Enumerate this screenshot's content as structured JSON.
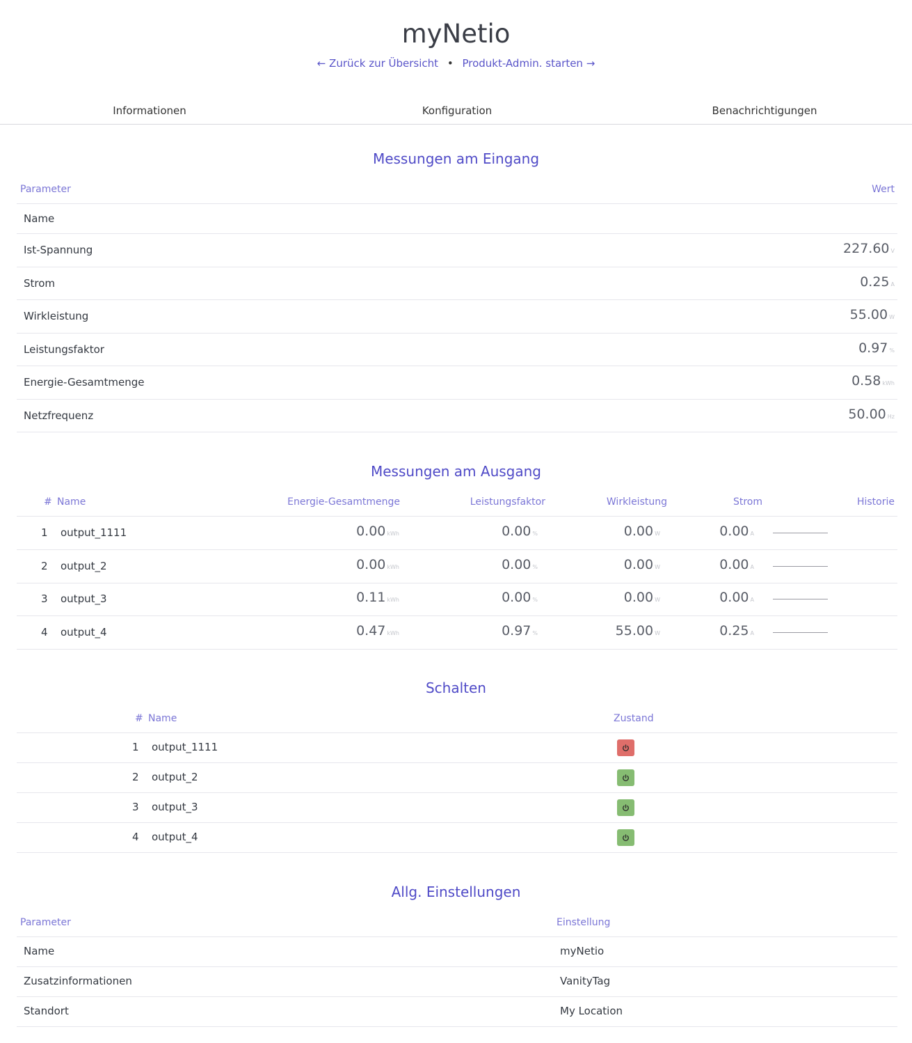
{
  "header": {
    "title": "myNetio",
    "back_link": "← Zurück zur Übersicht",
    "separator": "•",
    "admin_link": "Produkt-Admin. starten →"
  },
  "tabs": [
    "Informationen",
    "Konfiguration",
    "Benachrichtigungen"
  ],
  "input_section": {
    "title": "Messungen am Eingang",
    "col_param": "Parameter",
    "col_value": "Wert",
    "rows": [
      {
        "label": "Name",
        "value": "",
        "unit": ""
      },
      {
        "label": "Ist-Spannung",
        "value": "227.60",
        "unit": "V"
      },
      {
        "label": "Strom",
        "value": "0.25",
        "unit": "A"
      },
      {
        "label": "Wirkleistung",
        "value": "55.00",
        "unit": "W"
      },
      {
        "label": "Leistungsfaktor",
        "value": "0.97",
        "unit": "%"
      },
      {
        "label": "Energie-Gesamtmenge",
        "value": "0.58",
        "unit": "kWh"
      },
      {
        "label": "Netzfrequenz",
        "value": "50.00",
        "unit": "Hz"
      }
    ]
  },
  "output_section": {
    "title": "Messungen am Ausgang",
    "columns": {
      "num": "#",
      "name": "Name",
      "energy": "Energie-Gesamtmenge",
      "pf": "Leistungsfaktor",
      "power": "Wirkleistung",
      "current": "Strom",
      "history": "Historie"
    },
    "units": {
      "energy": "kWh",
      "pf": "%",
      "power": "W",
      "current": "A"
    },
    "rows": [
      {
        "num": "1",
        "name": "output_1111",
        "energy": "0.00",
        "pf": "0.00",
        "power": "0.00",
        "current": "0.00"
      },
      {
        "num": "2",
        "name": "output_2",
        "energy": "0.00",
        "pf": "0.00",
        "power": "0.00",
        "current": "0.00"
      },
      {
        "num": "3",
        "name": "output_3",
        "energy": "0.11",
        "pf": "0.00",
        "power": "0.00",
        "current": "0.00"
      },
      {
        "num": "4",
        "name": "output_4",
        "energy": "0.47",
        "pf": "0.97",
        "power": "55.00",
        "current": "0.25"
      }
    ]
  },
  "switch_section": {
    "title": "Schalten",
    "col_num": "#",
    "col_name": "Name",
    "col_state": "Zustand",
    "rows": [
      {
        "num": "1",
        "name": "output_1111",
        "state": "off",
        "icon": "power-icon"
      },
      {
        "num": "2",
        "name": "output_2",
        "state": "on",
        "icon": "power-icon"
      },
      {
        "num": "3",
        "name": "output_3",
        "state": "on",
        "icon": "power-icon"
      },
      {
        "num": "4",
        "name": "output_4",
        "state": "on",
        "icon": "power-icon"
      }
    ],
    "colors": {
      "off": "#df6e6a",
      "on": "#86bc72"
    }
  },
  "settings_section": {
    "title": "Allg. Einstellungen",
    "col_param": "Parameter",
    "col_setting": "Einstellung",
    "rows": [
      {
        "label": "Name",
        "value": "myNetio"
      },
      {
        "label": "Zusatzinformationen",
        "value": "VanityTag"
      },
      {
        "label": "Standort",
        "value": "My Location"
      }
    ]
  }
}
